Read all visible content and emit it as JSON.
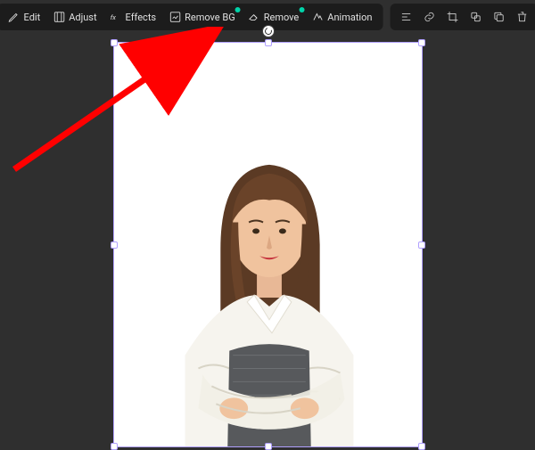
{
  "toolbar": {
    "edit": "Edit",
    "adjust": "Adjust",
    "effects": "Effects",
    "remove_bg": "Remove BG",
    "remove": "Remove",
    "animation": "Animation"
  },
  "colors": {
    "accent": "#00d4aa",
    "selection": "#b0a0ff",
    "arrow": "#ff0000"
  },
  "annotation": {
    "direction": "arrow pointing to Remove BG"
  }
}
